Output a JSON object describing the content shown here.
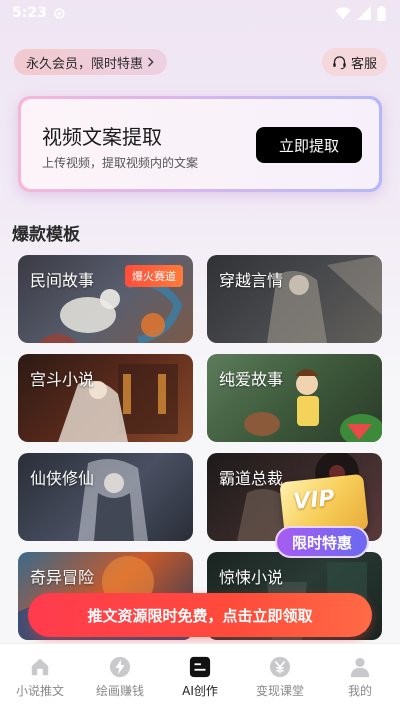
{
  "status_bar": {
    "time": "5:23"
  },
  "header": {
    "member_label": "永久会员，限时特惠",
    "service_label": "客服"
  },
  "extract_card": {
    "title": "视频文案提取",
    "subtitle": "上传视频，提取视频内的文案",
    "button_label": "立即提取"
  },
  "section": {
    "title": "爆款模板"
  },
  "templates": [
    {
      "label": "民间故事",
      "badge": "爆火赛道"
    },
    {
      "label": "穿越言情"
    },
    {
      "label": "宫斗小说"
    },
    {
      "label": "纯爱故事"
    },
    {
      "label": "仙侠修仙"
    },
    {
      "label": "霸道总裁"
    },
    {
      "label": "奇异冒险"
    },
    {
      "label": "惊悚小说"
    }
  ],
  "vip_float": {
    "vip_text": "VIP",
    "badge_label": "限时特惠"
  },
  "promo_banner": {
    "text": "推文资源限时免费，点击立即领取"
  },
  "tabbar": {
    "items": [
      {
        "label": "小说推文",
        "icon": "home-icon"
      },
      {
        "label": "绘画赚钱",
        "icon": "lightning-icon"
      },
      {
        "label": "AI创作",
        "icon": "ai-create-icon",
        "active": true
      },
      {
        "label": "变现课堂",
        "icon": "yen-icon"
      },
      {
        "label": "我的",
        "icon": "user-icon"
      }
    ]
  }
}
